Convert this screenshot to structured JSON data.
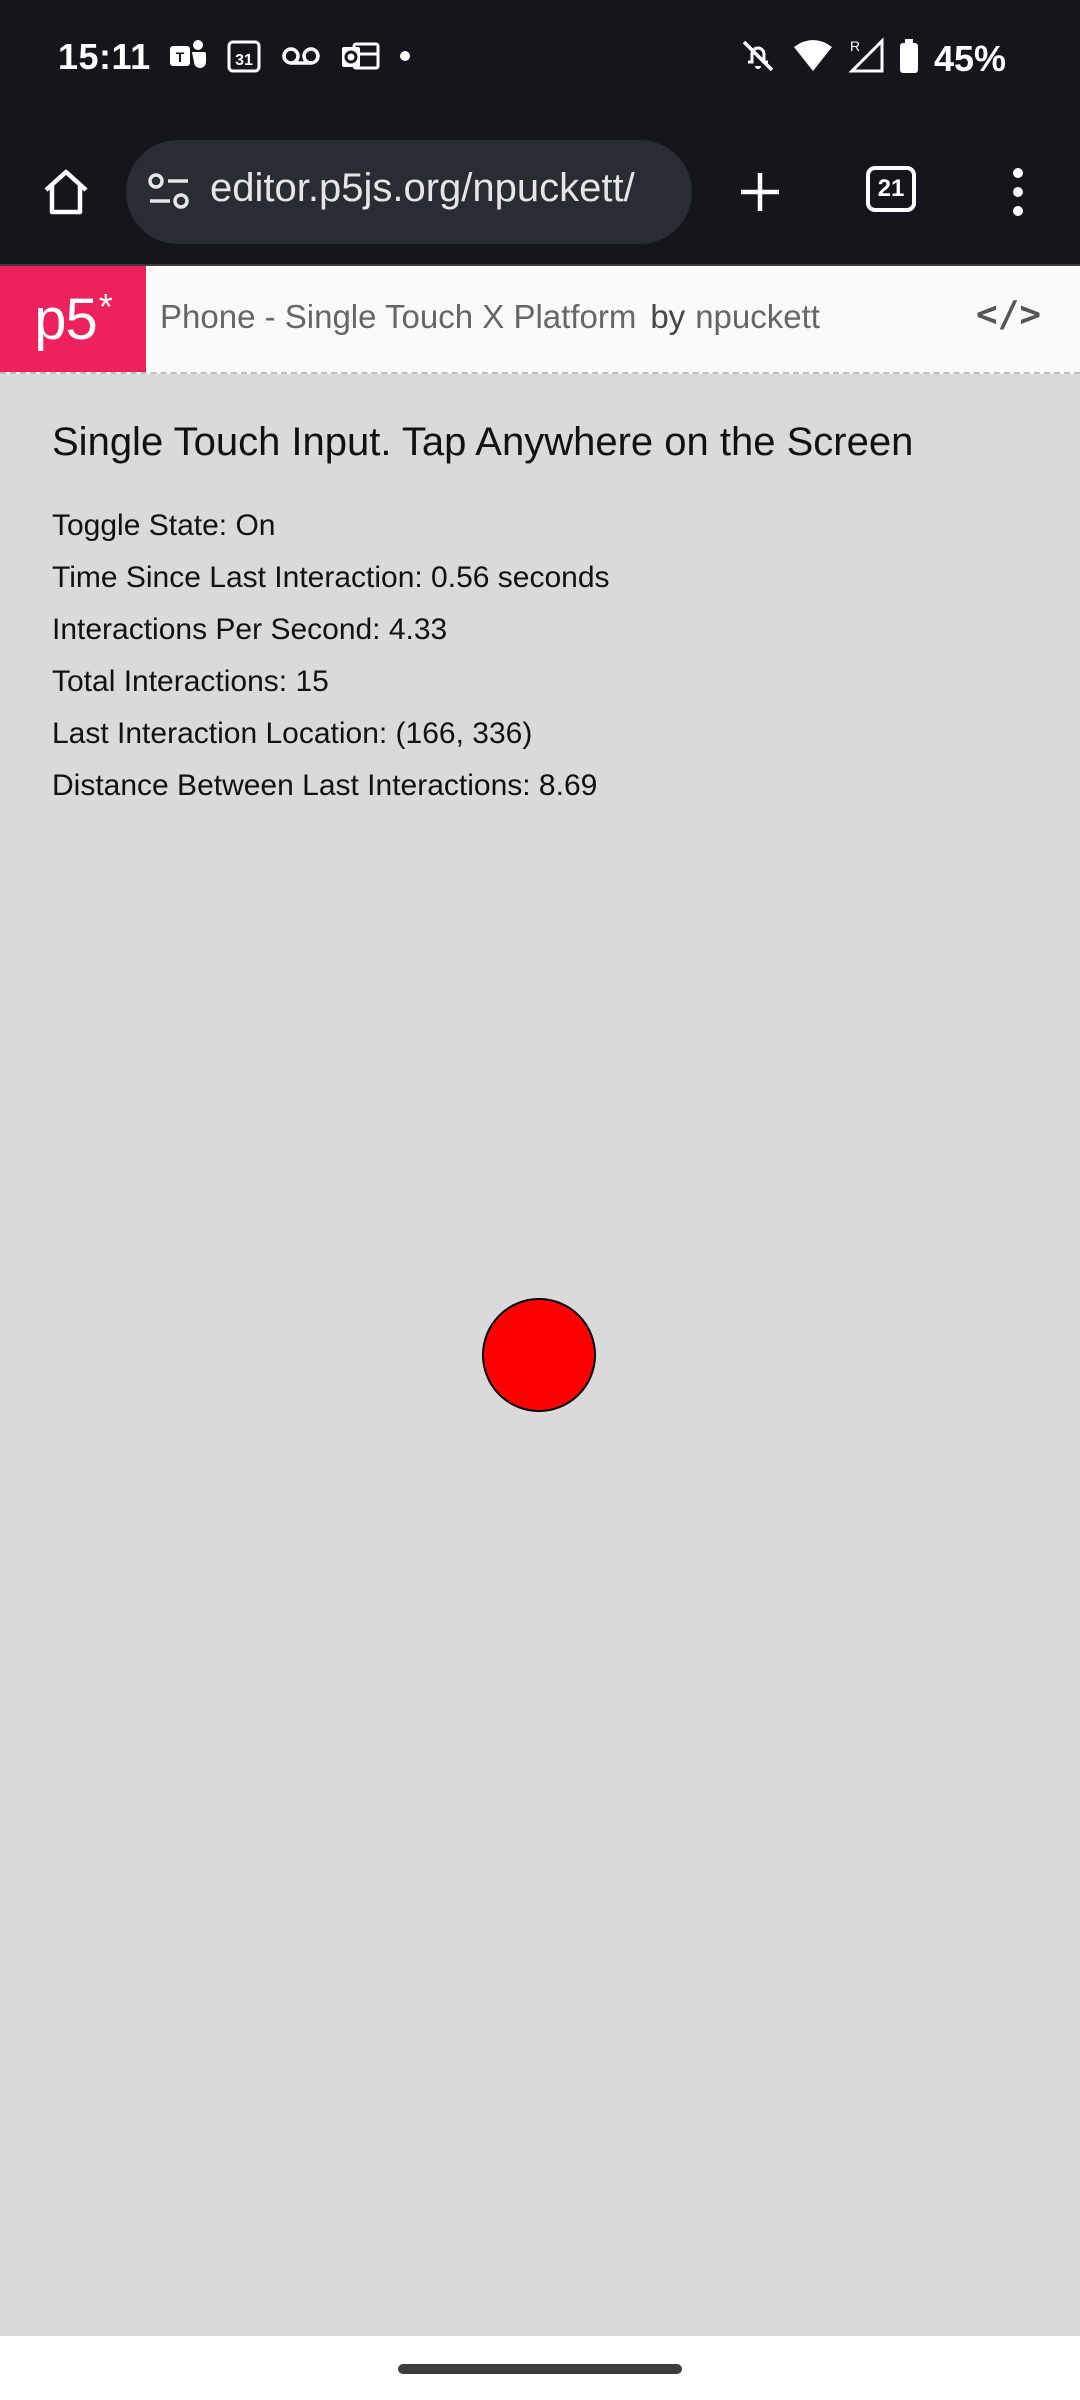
{
  "status_bar": {
    "time": "15:11",
    "notification_icons": [
      "teams-icon",
      "calendar-icon",
      "voicemail-icon",
      "outlook-icon",
      "dot-icon"
    ],
    "calendar_day": "31",
    "battery_percent": "45%",
    "roaming_label": "R"
  },
  "toolbar": {
    "url": "editor.p5js.org/npuckett/",
    "tab_count": "21"
  },
  "p5_header": {
    "logo_text": "p5",
    "logo_asterisk": "*",
    "sketch_name": "Phone - Single Touch X Platform",
    "by_label": "by",
    "author": "npuckett",
    "code_toggle": "</>"
  },
  "canvas": {
    "heading": "Single Touch Input. Tap Anywhere on the Screen",
    "stats": [
      "Toggle State: On",
      "Time Since Last Interaction: 0.56 seconds",
      "Interactions Per Second: 4.33",
      "Total Interactions: 15",
      "Last Interaction Location: (166, 336)",
      "Distance Between Last Interactions: 8.69"
    ],
    "dot_color": "#ff0000"
  },
  "colors": {
    "p5_brand": "#ed225d",
    "system_bar": "#15161b",
    "canvas_bg": "#dadada"
  }
}
